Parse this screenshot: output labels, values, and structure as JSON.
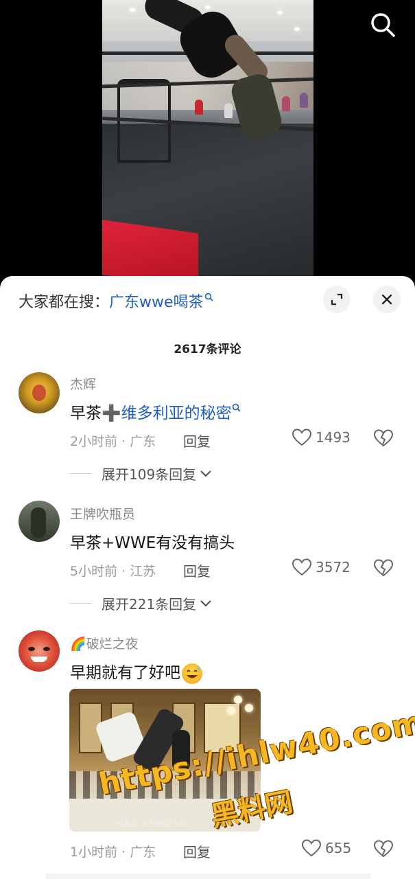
{
  "header": {
    "search_icon": "search-icon"
  },
  "hot_search": {
    "prefix": "大家都在搜：",
    "keyword": "广东wwe喝茶",
    "keyword_icon": "search-icon"
  },
  "sheet_buttons": {
    "expand_icon": "expand-icon",
    "close_icon": "close-icon"
  },
  "comments_header": {
    "count_label": "2617条评论"
  },
  "comments": [
    {
      "username": "杰辉",
      "text_prefix": "早茶➕",
      "text_link": "维多利亚的秘密",
      "time": "2小时前 · 广东",
      "reply_label": "回复",
      "likes": "1493",
      "expand_label": "展开109条回复"
    },
    {
      "username": "王牌吹瓶员",
      "text": "早茶+WWE有没有搞头",
      "time": "5小时前 · 江苏",
      "reply_label": "回复",
      "likes": "3572",
      "expand_label": "展开221条回复"
    },
    {
      "username": "🌈破烂之夜",
      "text": "早期就有了好吧",
      "emoji": "sweat-smile-emoji",
      "image_watermark": "抖音号: 63094233C",
      "time": "1小时前 · 广东",
      "reply_label": "回复",
      "likes": "655"
    }
  ],
  "watermark": {
    "url": "https://ihlw40.com",
    "cn": "黑料网"
  },
  "colors": {
    "link": "#1f5fbf",
    "watermark": "#f6b820"
  }
}
